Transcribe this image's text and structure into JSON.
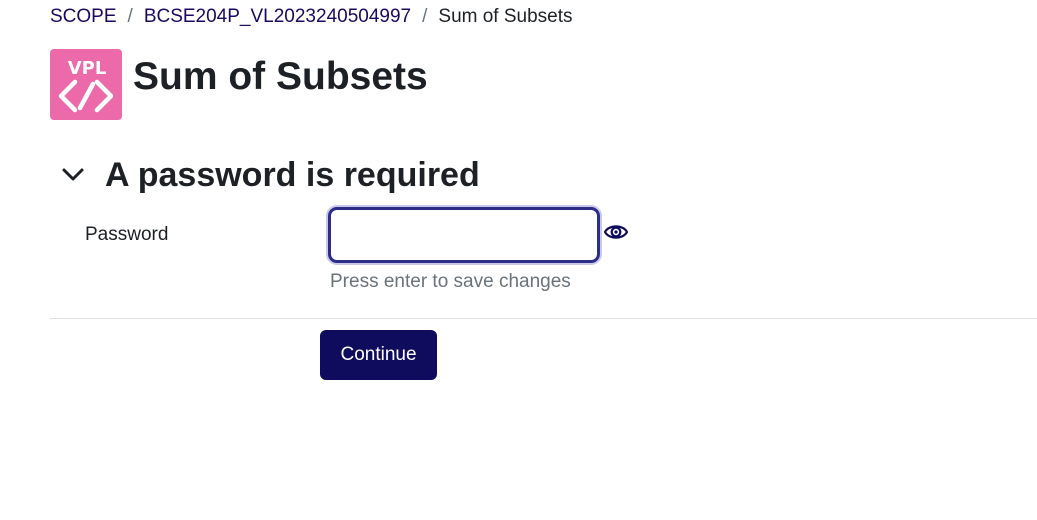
{
  "breadcrumb": {
    "items": [
      "SCOPE",
      "BCSE204P_VL2023240504997",
      "Sum of Subsets"
    ],
    "separator": "/"
  },
  "header": {
    "icon_text": "VPL",
    "icon_name": "vpl-code-icon",
    "icon_color": "#ec6aa9",
    "title": "Sum of Subsets"
  },
  "section": {
    "toggle_icon": "chevron-down-icon",
    "heading": "A password is required"
  },
  "form": {
    "password_label": "Password",
    "password_value": "",
    "password_placeholder": "",
    "reveal_icon": "eye-icon",
    "hint": "Press enter to save changes",
    "submit_label": "Continue"
  },
  "colors": {
    "link": "#1a0a5e",
    "primary_button": "#0f0c5e",
    "input_focus_border": "#2d2c86",
    "muted_text": "#6a737b"
  }
}
